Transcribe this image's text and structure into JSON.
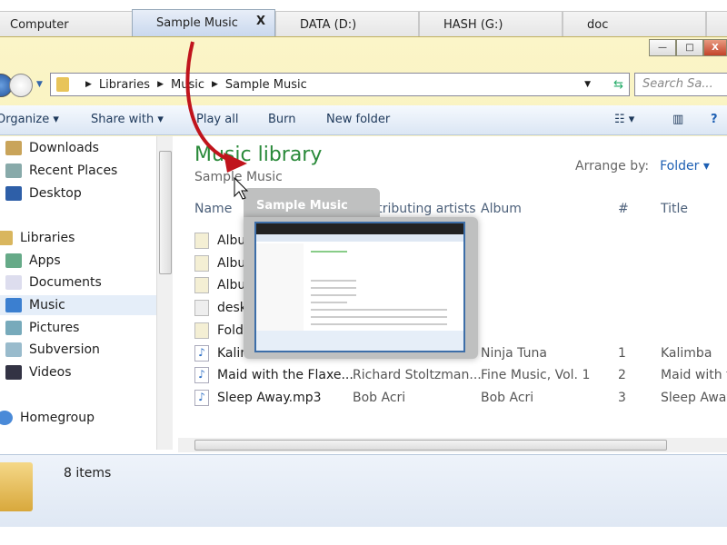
{
  "tabs": [
    {
      "label": "Computer"
    },
    {
      "label": "Sample Music",
      "active": true,
      "close": "X"
    },
    {
      "label": "DATA (D:)"
    },
    {
      "label": "HASH (G:)"
    },
    {
      "label": "doc"
    }
  ],
  "window": {
    "minimize": "—",
    "maximize": "□",
    "close": "X"
  },
  "address": {
    "crumbs": [
      "Libraries",
      "Music",
      "Sample Music"
    ],
    "search_placeholder": "Search Sa..."
  },
  "toolbar": {
    "organize": "Organize ▾",
    "share": "Share with ▾",
    "play": "Play all",
    "burn": "Burn",
    "new_folder": "New folder"
  },
  "sidebar": {
    "items": [
      {
        "label": "Downloads"
      },
      {
        "label": "Recent Places"
      },
      {
        "label": "Desktop"
      },
      {
        "label": "Libraries"
      },
      {
        "label": "Apps"
      },
      {
        "label": "Documents"
      },
      {
        "label": "Music",
        "selected": true
      },
      {
        "label": "Pictures"
      },
      {
        "label": "Subversion"
      },
      {
        "label": "Videos"
      },
      {
        "label": "Homegroup"
      }
    ]
  },
  "library": {
    "title": "Music library",
    "subtitle": "Sample Music",
    "arrange_label": "Arrange by:",
    "arrange_value": "Folder ▾"
  },
  "columns": [
    "Name",
    "Contributing artists",
    "Album",
    "#",
    "Title"
  ],
  "files": [
    {
      "name": "Albu",
      "icon": "image-file"
    },
    {
      "name": "Albu",
      "icon": "image-file"
    },
    {
      "name": "Albu",
      "icon": "image-file"
    },
    {
      "name": "deskt",
      "icon": "settings-file"
    },
    {
      "name": "Folde",
      "icon": "image-file"
    },
    {
      "name": "Kalim",
      "artist": "",
      "album": "Ninja Tuna",
      "num": "1",
      "title": "Kalimba",
      "icon": "music-file"
    },
    {
      "name": "Maid with the Flaxe...",
      "artist": "Richard Stoltzman...",
      "album": "Fine Music, Vol. 1",
      "num": "2",
      "title": "Maid with th",
      "icon": "music-file"
    },
    {
      "name": "Sleep Away.mp3",
      "artist": "Bob Acri",
      "album": "Bob Acri",
      "num": "3",
      "title": "Sleep Away",
      "icon": "music-file"
    }
  ],
  "status": {
    "count": "8 items"
  },
  "preview": {
    "title": "Sample Music"
  },
  "colors": {
    "accent": "#2a8a3a",
    "arrow": "#c0141c"
  }
}
